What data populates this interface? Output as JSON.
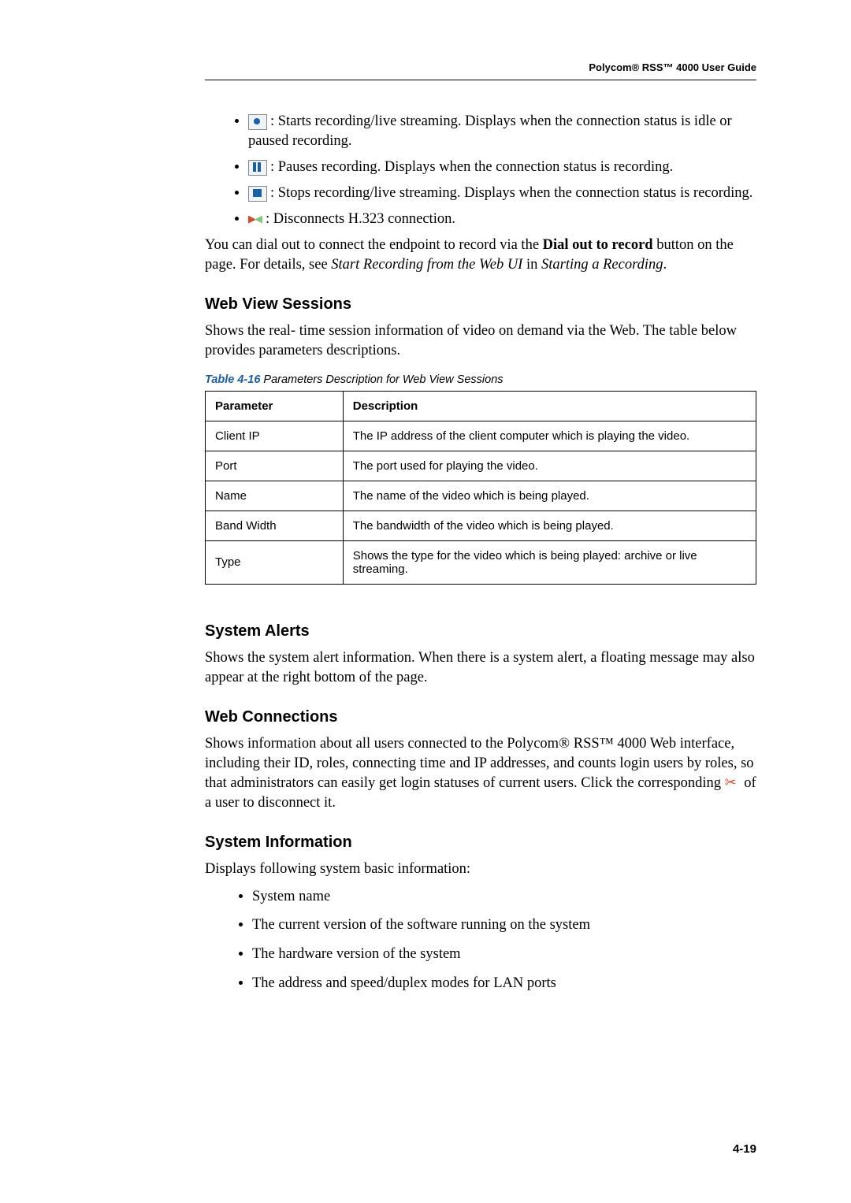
{
  "header": "Polycom® RSS™ 4000 User Guide",
  "top_bullets": [
    {
      "icon": "record",
      "text_after": ": Starts recording/live streaming. Displays when the connection status is idle or paused recording."
    },
    {
      "icon": "pause",
      "text_after": ": Pauses recording. Displays when the connection status is recording."
    },
    {
      "icon": "stop",
      "text_after": ": Stops recording/live streaming. Displays when the connection status is recording."
    },
    {
      "icon": "disconnect",
      "text_after": ": Disconnects H.323 connection."
    }
  ],
  "dialout": {
    "p1": "You can dial out to connect the endpoint to record via the ",
    "bold": "Dial out to record",
    "p2": " button on the page. For details, see ",
    "italic1": "Start Recording from the Web UI",
    "p3": " in ",
    "italic2": "Starting a Recording",
    "p4": "."
  },
  "sections": {
    "webview_title": "Web View Sessions",
    "webview_body": "Shows the real- time session information of video on demand via the Web. The table below provides parameters descriptions.",
    "table_caption_label": "Table 4-16",
    "table_caption_text": " Parameters Description for Web View Sessions",
    "table": {
      "h1": "Parameter",
      "h2": "Description",
      "rows": [
        {
          "p": "Client IP",
          "d": "The IP address of the client computer which is playing the video."
        },
        {
          "p": "Port",
          "d": "The port used for playing the video."
        },
        {
          "p": "Name",
          "d": "The name of the video which is being played."
        },
        {
          "p": "Band Width",
          "d": "The bandwidth of the video which is being played."
        },
        {
          "p": "Type",
          "d": "Shows the type for the video which is being played: archive or live streaming."
        }
      ]
    },
    "alerts_title": "System Alerts",
    "alerts_body": "Shows the system alert information. When there is a system alert, a floating message may also appear at the right bottom of the page.",
    "webconn_title": "Web Connections",
    "webconn_p1": "Shows information about all users connected to the Polycom® RSS™ 4000 Web interface, including their ID, roles, connecting time and IP addresses, and counts login users by roles, so that administrators can easily get login statuses of current users. Click the corresponding ",
    "webconn_p2": " of a user to disconnect it.",
    "sysinfo_title": "System Information",
    "sysinfo_intro": "Displays following system basic information:",
    "sysinfo_items": [
      "System name",
      "The current version of the software running on the system",
      "The hardware version of the system",
      "The address and speed/duplex modes for LAN ports"
    ]
  },
  "page_number": "4-19"
}
